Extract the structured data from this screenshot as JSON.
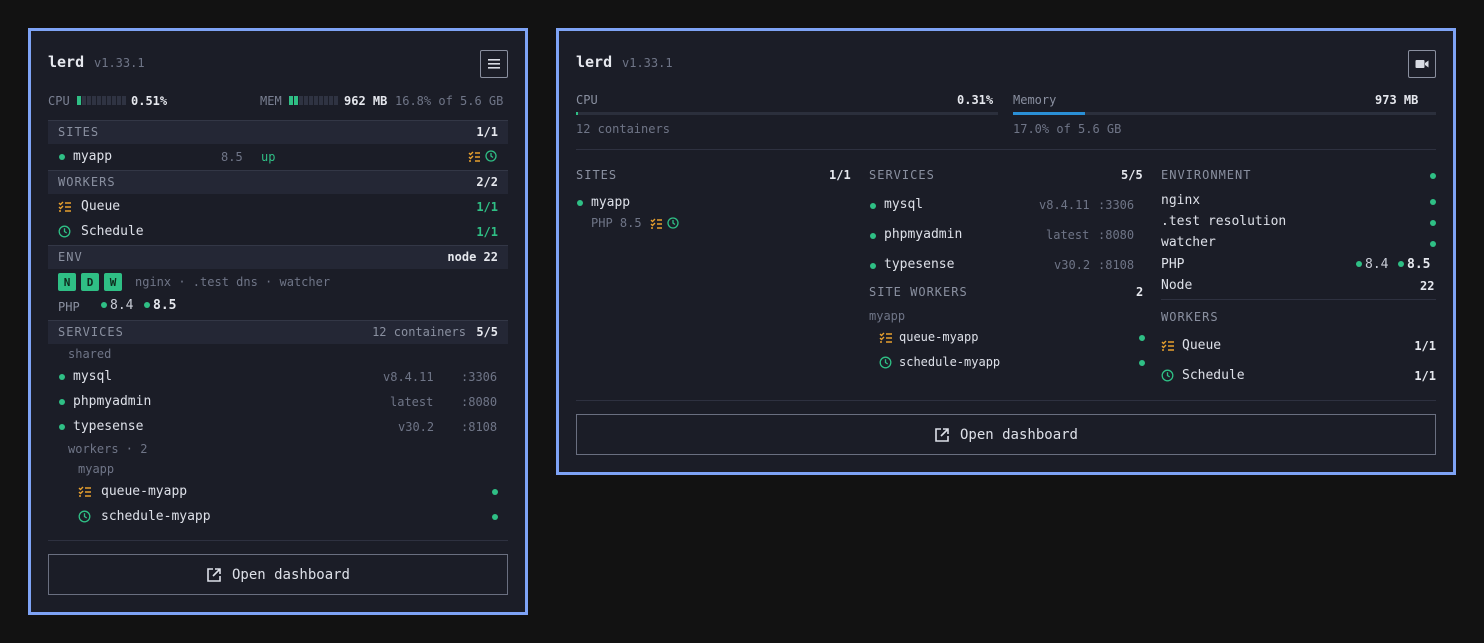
{
  "app": {
    "name": "lerd",
    "version": "v1.33.1"
  },
  "compact": {
    "cpu_label": "CPU",
    "cpu_value": "0.51%",
    "cpu_fraction": 0.0051,
    "mem_label": "MEM",
    "mem_value": "962 MB",
    "mem_detail": "16.8% of 5.6 GB",
    "mem_fraction": 0.168,
    "sites": {
      "label": "SITES",
      "count": "1/1",
      "items": [
        {
          "name": "myapp",
          "php": "8.5",
          "status": "up"
        }
      ]
    },
    "workers": {
      "label": "WORKERS",
      "count": "2/2",
      "items": [
        {
          "name": "Queue",
          "count": "1/1",
          "icon": "queue-icon"
        },
        {
          "name": "Schedule",
          "count": "1/1",
          "icon": "clock-icon"
        }
      ]
    },
    "env": {
      "label": "ENV",
      "node": "node 22",
      "badges": [
        "N",
        "D",
        "W"
      ],
      "desc": "nginx · .test dns · watcher",
      "php_label": "PHP",
      "php_versions": [
        "8.4",
        "8.5"
      ]
    },
    "services": {
      "label": "SERVICES",
      "containers": "12 containers",
      "count": "5/5",
      "shared_label": "shared",
      "items": [
        {
          "name": "mysql",
          "version": "v8.4.11",
          "port": ":3306"
        },
        {
          "name": "phpmyadmin",
          "version": "latest",
          "port": ":8080"
        },
        {
          "name": "typesense",
          "version": "v30.2",
          "port": ":8108"
        }
      ],
      "workers_label": "workers · 2",
      "worker_group": "myapp",
      "workers": [
        {
          "name": "queue-myapp",
          "icon": "queue-icon"
        },
        {
          "name": "schedule-myapp",
          "icon": "clock-icon"
        }
      ]
    },
    "dashboard_label": "Open dashboard"
  },
  "wide": {
    "cpu_label": "CPU",
    "cpu_value": "0.31%",
    "cpu_fraction": 0.0031,
    "cpu_sub": "12 containers",
    "mem_label": "Memory",
    "mem_value": "973 MB",
    "mem_sub": "17.0% of 5.6 GB",
    "mem_fraction": 0.17,
    "sites": {
      "label": "SITES",
      "count": "1/1",
      "items": [
        {
          "name": "myapp",
          "php": "PHP 8.5"
        }
      ]
    },
    "services": {
      "label": "SERVICES",
      "count": "5/5",
      "items": [
        {
          "name": "mysql",
          "version": "v8.4.11",
          "port": ":3306"
        },
        {
          "name": "phpmyadmin",
          "version": "latest",
          "port": ":8080"
        },
        {
          "name": "typesense",
          "version": "v30.2",
          "port": ":8108"
        }
      ],
      "site_workers_label": "SITE WORKERS",
      "site_workers_count": "2",
      "worker_group": "myapp",
      "workers": [
        {
          "name": "queue-myapp"
        },
        {
          "name": "schedule-myapp"
        }
      ]
    },
    "environment": {
      "label": "ENVIRONMENT",
      "items": [
        "nginx",
        ".test resolution",
        "watcher"
      ],
      "php_label": "PHP",
      "php_versions": [
        "8.4",
        "8.5"
      ],
      "node_label": "Node",
      "node_value": "22"
    },
    "workers": {
      "label": "WORKERS",
      "items": [
        {
          "name": "Queue",
          "count": "1/1"
        },
        {
          "name": "Schedule",
          "count": "1/1"
        }
      ]
    },
    "dashboard_label": "Open dashboard"
  },
  "colors": {
    "accent_border": "#7ea3f5",
    "green": "#2fbf85",
    "orange": "#e8a02e",
    "mem_bar_blue": "#2a8fd6",
    "background": "#121212",
    "panel": "#1b1d27"
  }
}
